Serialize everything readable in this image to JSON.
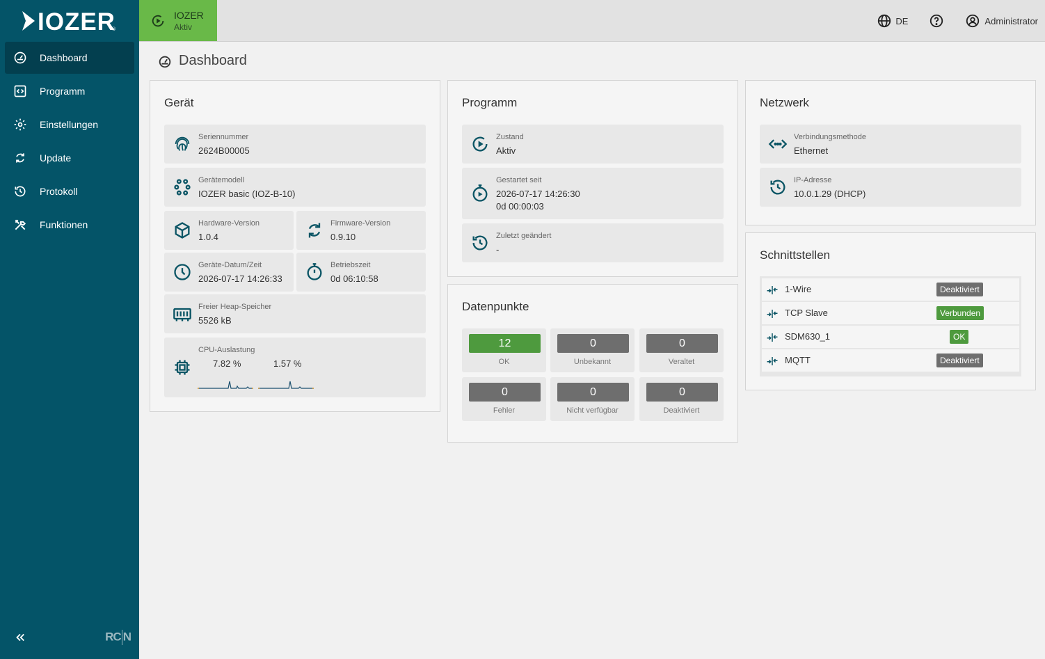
{
  "brand": {
    "name": "IOZER",
    "footer_logo_left": "RC",
    "footer_logo_right": "N"
  },
  "nav": [
    {
      "label": "Dashboard",
      "icon": "gauge-icon",
      "active": true
    },
    {
      "label": "Programm",
      "icon": "code-icon"
    },
    {
      "label": "Einstellungen",
      "icon": "gear-icon"
    },
    {
      "label": "Update",
      "icon": "refresh-icon"
    },
    {
      "label": "Protokoll",
      "icon": "history-icon"
    },
    {
      "label": "Funktionen",
      "icon": "tools-icon"
    }
  ],
  "topbar": {
    "program_name": "IOZER",
    "program_state": "Aktiv",
    "language": "DE",
    "user": "Administrator"
  },
  "page": {
    "title": "Dashboard"
  },
  "geraet": {
    "title": "Gerät",
    "serial_label": "Seriennummer",
    "serial": "2624B00005",
    "model_label": "Gerätemodell",
    "model": "IOZER basic (IOZ-B-10)",
    "hw_label": "Hardware-Version",
    "hw": "1.0.4",
    "fw_label": "Firmware-Version",
    "fw": "0.9.10",
    "datetime_label": "Geräte-Datum/Zeit",
    "datetime": "2026-07-17 14:26:33",
    "uptime_label": "Betriebszeit",
    "uptime": "0d 06:10:58",
    "heap_label": "Freier Heap-Speicher",
    "heap": "5526 kB",
    "cpu_label": "CPU-Auslastung",
    "cpu1": "7.82 %",
    "cpu2": "1.57 %"
  },
  "programm": {
    "title": "Programm",
    "state_label": "Zustand",
    "state": "Aktiv",
    "started_label": "Gestartet seit",
    "started": "2026-07-17 14:26:30",
    "started_dur": "0d 00:00:03",
    "changed_label": "Zuletzt geändert",
    "changed": "-"
  },
  "datenpunkte": {
    "title": "Datenpunkte",
    "items": [
      {
        "label": "OK",
        "value": "12",
        "color": "#4e9a3e"
      },
      {
        "label": "Unbekannt",
        "value": "0",
        "color": "#6e6e6e"
      },
      {
        "label": "Veraltet",
        "value": "0",
        "color": "#6e6e6e"
      },
      {
        "label": "Fehler",
        "value": "0",
        "color": "#6e6e6e"
      },
      {
        "label": "Nicht verfügbar",
        "value": "0",
        "color": "#6e6e6e"
      },
      {
        "label": "Deaktiviert",
        "value": "0",
        "color": "#6e6e6e"
      }
    ]
  },
  "netzwerk": {
    "title": "Netzwerk",
    "method_label": "Verbindungsmethode",
    "method": "Ethernet",
    "ip_label": "IP-Adresse",
    "ip": "10.0.1.29 (DHCP)"
  },
  "schnittstellen": {
    "title": "Schnittstellen",
    "items": [
      {
        "name": "1-Wire",
        "status": "Deaktiviert",
        "color": "#6e6e6e"
      },
      {
        "name": "TCP Slave",
        "status": "Verbunden",
        "color": "#4e9a3e"
      },
      {
        "name": "SDM630_1",
        "status": "OK",
        "color": "#4e9a3e"
      },
      {
        "name": "MQTT",
        "status": "Deaktiviert",
        "color": "#6e6e6e"
      }
    ]
  },
  "colors": {
    "sidebar": "#045468",
    "accent_green": "#69b948",
    "icon_teal": "#0b5565"
  }
}
